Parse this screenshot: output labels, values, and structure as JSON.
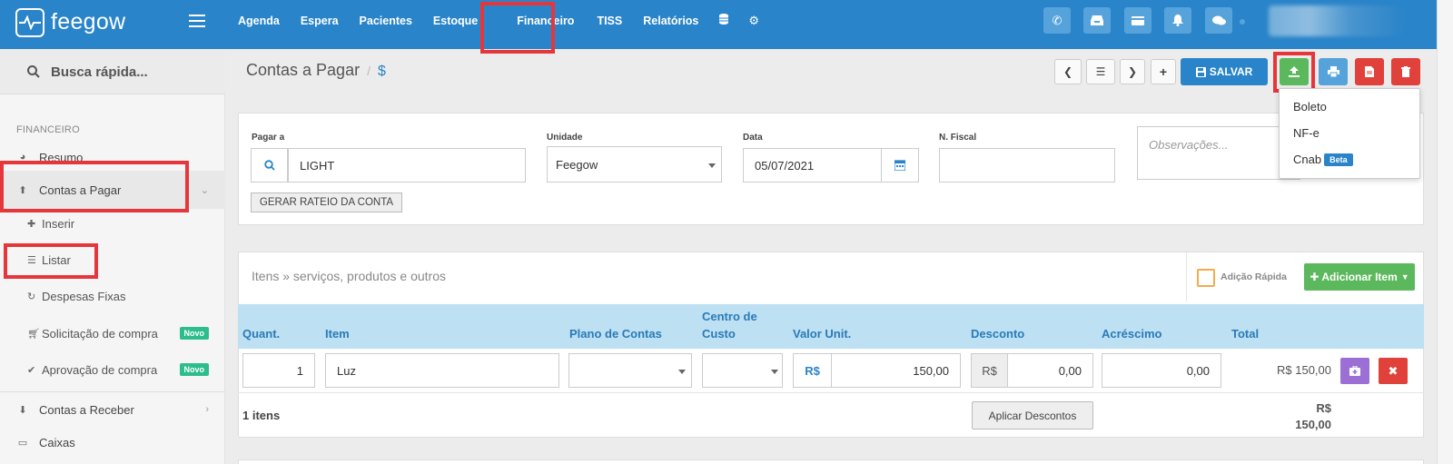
{
  "brand": {
    "name": "feegow"
  },
  "topnav": {
    "items": [
      "Agenda",
      "Espera",
      "Pacientes",
      "Estoque",
      "Financeiro",
      "TISS",
      "Relatórios"
    ],
    "active": "Financeiro"
  },
  "sidebar": {
    "search_label": "Busca rápida...",
    "section": "FINANCEIRO",
    "items": {
      "resumo": "Resumo",
      "contas_pagar": "Contas a Pagar",
      "inserir": "Inserir",
      "listar": "Listar",
      "despesas": "Despesas Fixas",
      "solicitacao": "Solicitação de compra",
      "aprovacao": "Aprovação de compra",
      "contas_receber": "Contas a Receber",
      "caixas": "Caixas"
    },
    "badge_new": "Novo"
  },
  "header": {
    "title": "Contas a Pagar",
    "separator": "/",
    "currency_symbol": "$",
    "save_label": "SALVAR"
  },
  "dropdown": {
    "items": [
      "Boleto",
      "NF-e",
      "Cnab"
    ],
    "beta_badge": "Beta"
  },
  "form": {
    "pagar_a": {
      "label": "Pagar a",
      "value": "LIGHT"
    },
    "unidade": {
      "label": "Unidade",
      "value": "Feegow"
    },
    "data": {
      "label": "Data",
      "value": "05/07/2021"
    },
    "nfiscal": {
      "label": "N. Fiscal",
      "value": ""
    },
    "observacoes": {
      "placeholder": "Observações..."
    },
    "rateio_label": "GERAR RATEIO DA CONTA"
  },
  "items": {
    "title": "Itens » serviços, produtos e outros",
    "quick_add_label": "Adição Rápida",
    "add_button": "Adicionar Item",
    "columns": {
      "quant": "Quant.",
      "item": "Item",
      "plano": "Plano de Contas",
      "centro_line1": "Centro de",
      "centro_line2": "Custo",
      "valor": "Valor Unit.",
      "desconto": "Desconto",
      "acrescimo": "Acréscimo",
      "total": "Total"
    },
    "rows": [
      {
        "quant": "1",
        "item": "Luz",
        "currency": "R$",
        "valor": "150,00",
        "desconto_currency": "R$",
        "desconto": "0,00",
        "acrescimo": "0,00",
        "total": "R$ 150,00"
      }
    ],
    "count_label": "1 itens",
    "apply_discounts": "Aplicar Descontos",
    "footer_total_line1": "R$",
    "footer_total_line2": "150,00"
  },
  "colors": {
    "primary": "#2a84c9",
    "success": "#5cb85c",
    "danger": "#e0413a",
    "highlight_box": "#e5363c",
    "table_header": "#bde0f2"
  }
}
